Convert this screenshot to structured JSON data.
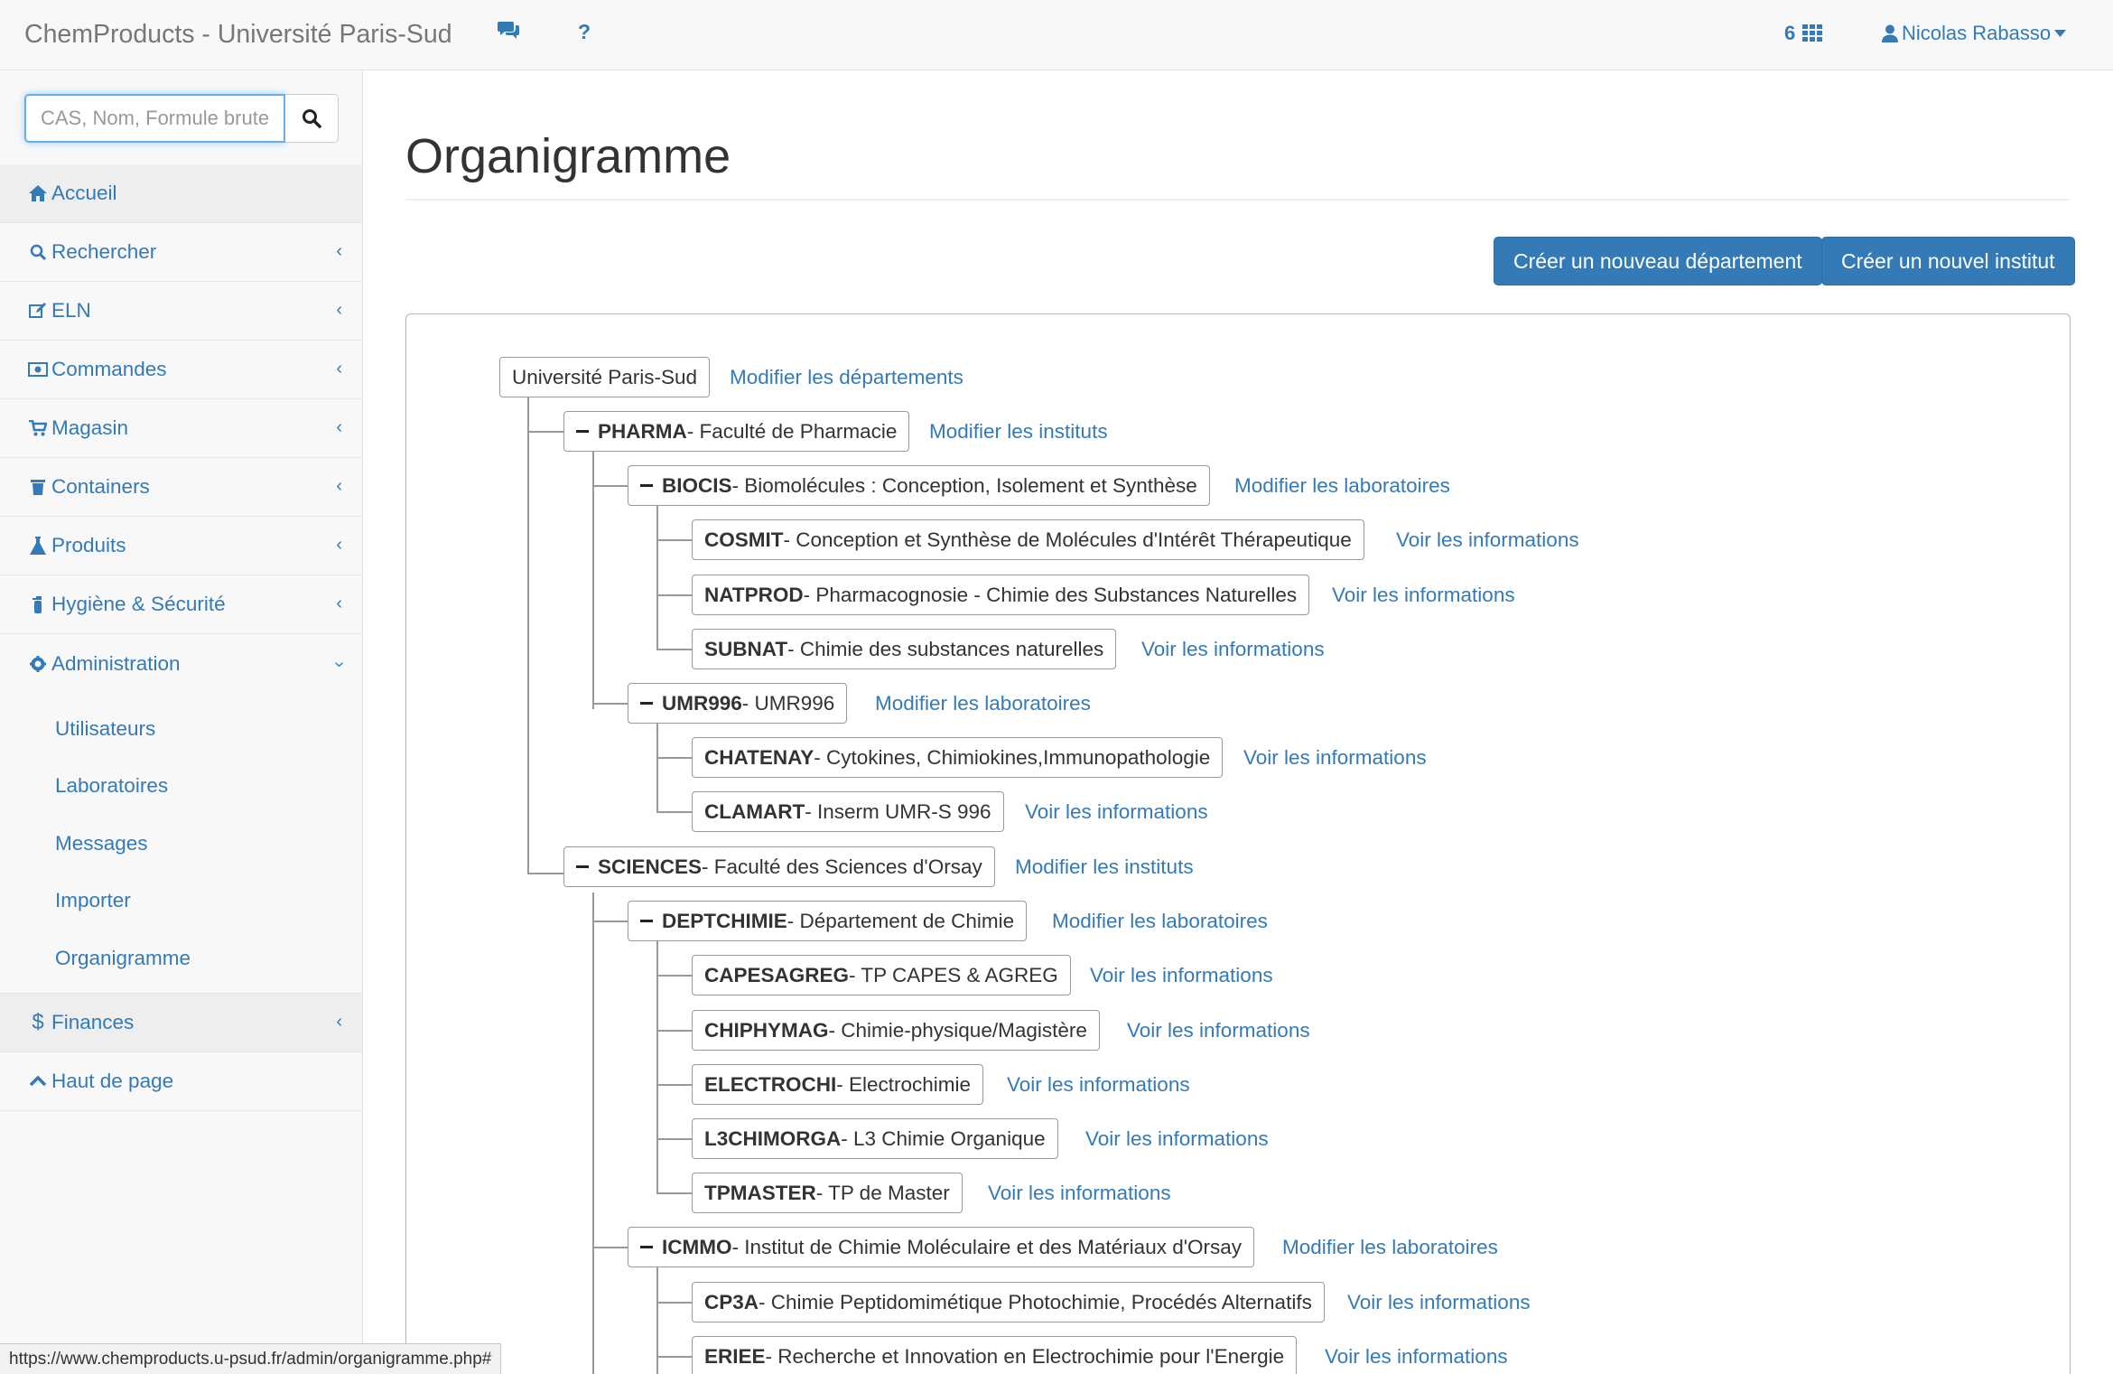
{
  "navbar": {
    "brand": "ChemProducts - Université Paris-Sud",
    "chat_icon": "comments-icon",
    "help_icon": "question-icon",
    "apps_count": "6",
    "apps_icon": "grid-icon",
    "user_name": "Nicolas Rabasso",
    "user_icon": "user-icon",
    "accent": "#337ab7"
  },
  "search": {
    "placeholder": "CAS, Nom, Formule brute",
    "icon": "search-icon"
  },
  "sidebar": {
    "items": [
      {
        "label": "Accueil",
        "icon": "home-icon"
      },
      {
        "label": "Rechercher",
        "icon": "search-icon"
      },
      {
        "label": "ELN",
        "icon": "edit-icon"
      },
      {
        "label": "Commandes",
        "icon": "money-icon"
      },
      {
        "label": "Magasin",
        "icon": "cart-icon"
      },
      {
        "label": "Containers",
        "icon": "trash-icon"
      },
      {
        "label": "Produits",
        "icon": "flask-icon"
      },
      {
        "label": "Hygiène & Sécurité",
        "icon": "extinguisher-icon"
      },
      {
        "label": "Administration",
        "icon": "gear-icon"
      }
    ],
    "admin_sub": [
      "Utilisateurs",
      "Laboratoires",
      "Messages",
      "Importer",
      "Organigramme"
    ],
    "finances": {
      "label": "Finances",
      "icon": "dollar-icon"
    },
    "top": {
      "label": "Haut de page",
      "icon": "chevron-up-icon"
    }
  },
  "main": {
    "title": "Organigramme",
    "btn_new_department": "Créer un nouveau département",
    "btn_new_institute": "Créer un nouvel institut"
  },
  "tree": {
    "root": {
      "label": "Université Paris-Sud",
      "link": "Modifier les départements"
    },
    "pharma": {
      "code": "PHARMA",
      "name": " - Faculté de Pharmacie",
      "link": "Modifier les instituts"
    },
    "biocis": {
      "code": "BIOCIS",
      "name": " - Biomolécules : Conception, Isolement et Synthèse",
      "link": "Modifier les laboratoires"
    },
    "cosmit": {
      "code": "COSMIT",
      "name": " - Conception et Synthèse de Molécules d'Intérêt Thérapeutique",
      "link": "Voir les informations"
    },
    "natprod": {
      "code": "NATPROD",
      "name": " - Pharmacognosie - Chimie des Substances Naturelles",
      "link": "Voir les informations"
    },
    "subnat": {
      "code": "SUBNAT",
      "name": " - Chimie des substances naturelles",
      "link": "Voir les informations"
    },
    "umr996": {
      "code": "UMR996",
      "name": " - UMR996",
      "link": "Modifier les laboratoires"
    },
    "chatenay": {
      "code": "CHATENAY",
      "name": " - Cytokines, Chimiokines,Immunopathologie",
      "link": "Voir les informations"
    },
    "clamart": {
      "code": "CLAMART",
      "name": " - Inserm UMR-S 996",
      "link": "Voir les informations"
    },
    "sciences": {
      "code": "SCIENCES",
      "name": " - Faculté des Sciences d'Orsay",
      "link": "Modifier les instituts"
    },
    "deptchimie": {
      "code": "DEPTCHIMIE",
      "name": " - Département de Chimie",
      "link": "Modifier les laboratoires"
    },
    "capesagreg": {
      "code": "CAPESAGREG",
      "name": " - TP CAPES & AGREG",
      "link": "Voir les informations"
    },
    "chiphymag": {
      "code": "CHIPHYMAG",
      "name": " - Chimie-physique/Magistère",
      "link": "Voir les informations"
    },
    "electrochi": {
      "code": "ELECTROCHI",
      "name": " - Electrochimie",
      "link": "Voir les informations"
    },
    "l3chimorga": {
      "code": "L3CHIMORGA",
      "name": " - L3 Chimie Organique",
      "link": "Voir les informations"
    },
    "tpmaster": {
      "code": "TPMASTER",
      "name": " - TP de Master",
      "link": "Voir les informations"
    },
    "icmmo": {
      "code": "ICMMO",
      "name": " - Institut de Chimie Moléculaire et des Matériaux d'Orsay",
      "link": "Modifier les laboratoires"
    },
    "cp3a": {
      "code": "CP3A",
      "name": " - Chimie Peptidomimétique Photochimie, Procédés Alternatifs",
      "link": "Voir les informations"
    },
    "eriee": {
      "code": "ERIEE",
      "name": " - Recherche et Innovation en Electrochimie pour l'Energie",
      "link": "Voir les informations"
    }
  },
  "statusbar": {
    "url": "https://www.chemproducts.u-psud.fr/admin/organigramme.php#"
  }
}
